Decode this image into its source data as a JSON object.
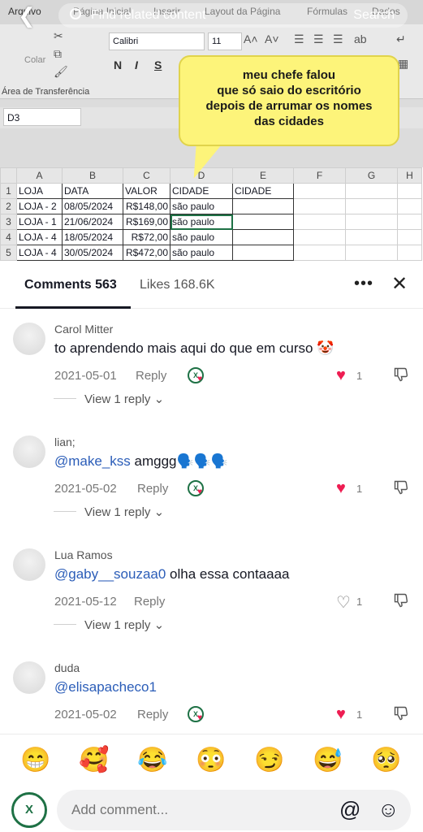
{
  "overlay": {
    "find_related": "Find related content",
    "search": "Search"
  },
  "excel": {
    "tabs": [
      "Arquivo",
      "Página Inicial",
      "Inserir",
      "Layout da Página",
      "Fórmulas",
      "Dados"
    ],
    "paste_label": "Colar",
    "clipboard_label": "Área de Transferência",
    "font_name": "Calibri",
    "font_size": "11",
    "bold": "N",
    "italic": "I",
    "underline": "S",
    "name_box": "D3",
    "callout": [
      "meu chefe falou",
      "que só saio do escritório",
      "depois de arrumar os nomes",
      "das cidades"
    ],
    "columns": [
      "A",
      "B",
      "C",
      "D",
      "E",
      "F",
      "G",
      "H"
    ],
    "header_row": [
      "LOJA",
      "DATA",
      "VALOR",
      "CIDADE",
      "CIDADE"
    ],
    "rows": [
      {
        "n": "2",
        "loja": "LOJA - 2",
        "data": "08/05/2024",
        "valor": "R$148,00",
        "cidade": "são paulo"
      },
      {
        "n": "3",
        "loja": "LOJA - 1",
        "data": "21/06/2024",
        "valor": "R$169,00",
        "cidade": "são paulo"
      },
      {
        "n": "4",
        "loja": "LOJA - 4",
        "data": "18/05/2024",
        "valor": "R$72,00",
        "cidade": "são paulo"
      },
      {
        "n": "5",
        "loja": "LOJA - 4",
        "data": "30/05/2024",
        "valor": "R$472,00",
        "cidade": "são paulo"
      }
    ],
    "first_row_num": "1"
  },
  "panel": {
    "comments_tab": "Comments 563",
    "likes_tab": "Likes 168.6K"
  },
  "comments": [
    {
      "user": "Carol Mitter",
      "mention": "",
      "text": "to aprendendo mais aqui do que em curso 🤡",
      "date": "2021-05-01",
      "reply": "Reply",
      "likes": "1",
      "liked": true,
      "view_replies": "View 1 reply"
    },
    {
      "user": "lian;",
      "mention": "@make_kss",
      "text": " amggg🗣️🗣️🗣️",
      "date": "2021-05-02",
      "reply": "Reply",
      "likes": "1",
      "liked": true,
      "view_replies": "View 1 reply"
    },
    {
      "user": "Lua Ramos",
      "mention": "@gaby__souzaa0",
      "text": " olha essa contaaaa",
      "date": "2021-05-12",
      "reply": "Reply",
      "likes": "1",
      "liked": false,
      "view_replies": "View 1 reply"
    },
    {
      "user": "duda",
      "mention": "@elisapacheco1",
      "text": "",
      "date": "2021-05-02",
      "reply": "Reply",
      "likes": "1",
      "liked": true,
      "view_replies": ""
    }
  ],
  "emojis": [
    "😁",
    "🥰",
    "😂",
    "😳",
    "😏",
    "😅",
    "🥺"
  ],
  "input": {
    "placeholder": "Add comment...",
    "avatar_text": "X"
  },
  "colors": {
    "like_red": "#ee1d52",
    "mention_blue": "#2b5db8",
    "excel_green": "#1e7145",
    "callout_yellow": "#fdf47a"
  }
}
